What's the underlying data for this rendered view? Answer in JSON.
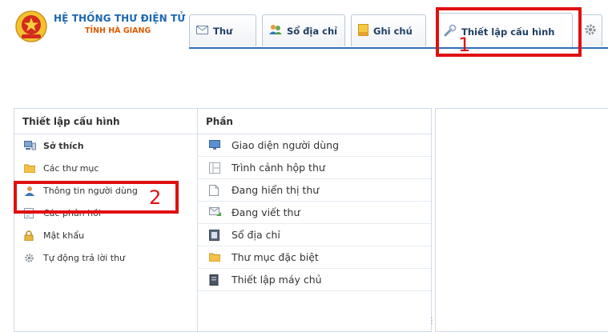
{
  "brand": {
    "title": "HỆ THỐNG THƯ ĐIỆN TỬ",
    "subtitle": "TỈNH HÀ GIANG"
  },
  "tabs": [
    {
      "label": "Thư",
      "icon": "mail-icon"
    },
    {
      "label": "Sổ địa chỉ",
      "icon": "contacts-icon"
    },
    {
      "label": "Ghi chú",
      "icon": "note-icon"
    },
    {
      "label": "Thiết lập cấu hình",
      "icon": "tools-icon",
      "active": true
    },
    {
      "label": "",
      "icon": "gear-icon"
    }
  ],
  "annotations": {
    "one": "1",
    "two": "2"
  },
  "settings_panel": {
    "title": "Thiết lập cấu hình",
    "items": [
      {
        "label": "Sở thích",
        "icon": "preferences-icon",
        "selected": true
      },
      {
        "label": "Các thư mục",
        "icon": "folder-icon"
      },
      {
        "label": "Thông tin người dùng",
        "icon": "user-icon"
      },
      {
        "label": "Các phản hồi",
        "icon": "responses-icon"
      },
      {
        "label": "Mật khẩu",
        "icon": "lock-icon"
      },
      {
        "label": "Tự động trả lời thư",
        "icon": "gear-icon"
      }
    ]
  },
  "section_panel": {
    "title": "Phần",
    "items": [
      {
        "label": "Giao diện người dùng",
        "icon": "monitor-icon"
      },
      {
        "label": "Trình cảnh hộp thư",
        "icon": "layout-icon"
      },
      {
        "label": "Đang hiển thị thư",
        "icon": "page-icon"
      },
      {
        "label": "Đang viết thư",
        "icon": "compose-icon"
      },
      {
        "label": "Sổ địa chỉ",
        "icon": "addressbook-icon"
      },
      {
        "label": "Thư mục đặc biệt",
        "icon": "folder-icon"
      },
      {
        "label": "Thiết lập máy chủ",
        "icon": "server-icon"
      }
    ]
  },
  "colors": {
    "accent": "#2f6eb5",
    "callout": "#e01010",
    "brand_title": "#1e67b2",
    "brand_sub": "#e05a00"
  }
}
